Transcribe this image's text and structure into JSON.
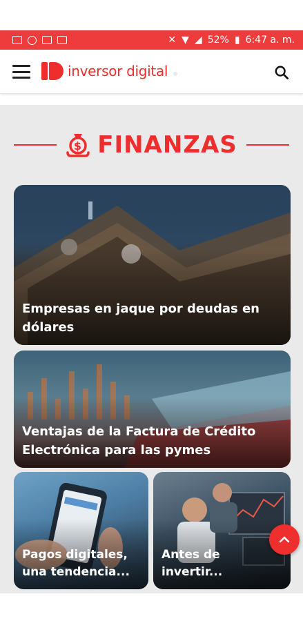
{
  "status_bar": {
    "battery": "52%",
    "time": "6:47 a. m."
  },
  "header": {
    "brand": "inversor digital"
  },
  "section": {
    "title": "FINANZAS"
  },
  "cards": [
    {
      "title": "Empresas en jaque por deudas en dólares"
    },
    {
      "title": "Ventajas de la Factura de Crédito Electrónica para las pymes"
    },
    {
      "title": "Pagos digitales, una tendencia..."
    },
    {
      "title": "Antes de invertir..."
    }
  ],
  "colors": {
    "brand_red": "#ee2d2d",
    "status_bar": "#ee3b3b",
    "background": "#eaeaea"
  },
  "icons": [
    "menu-icon",
    "search-icon",
    "money-bag-icon",
    "chevron-up-icon"
  ]
}
